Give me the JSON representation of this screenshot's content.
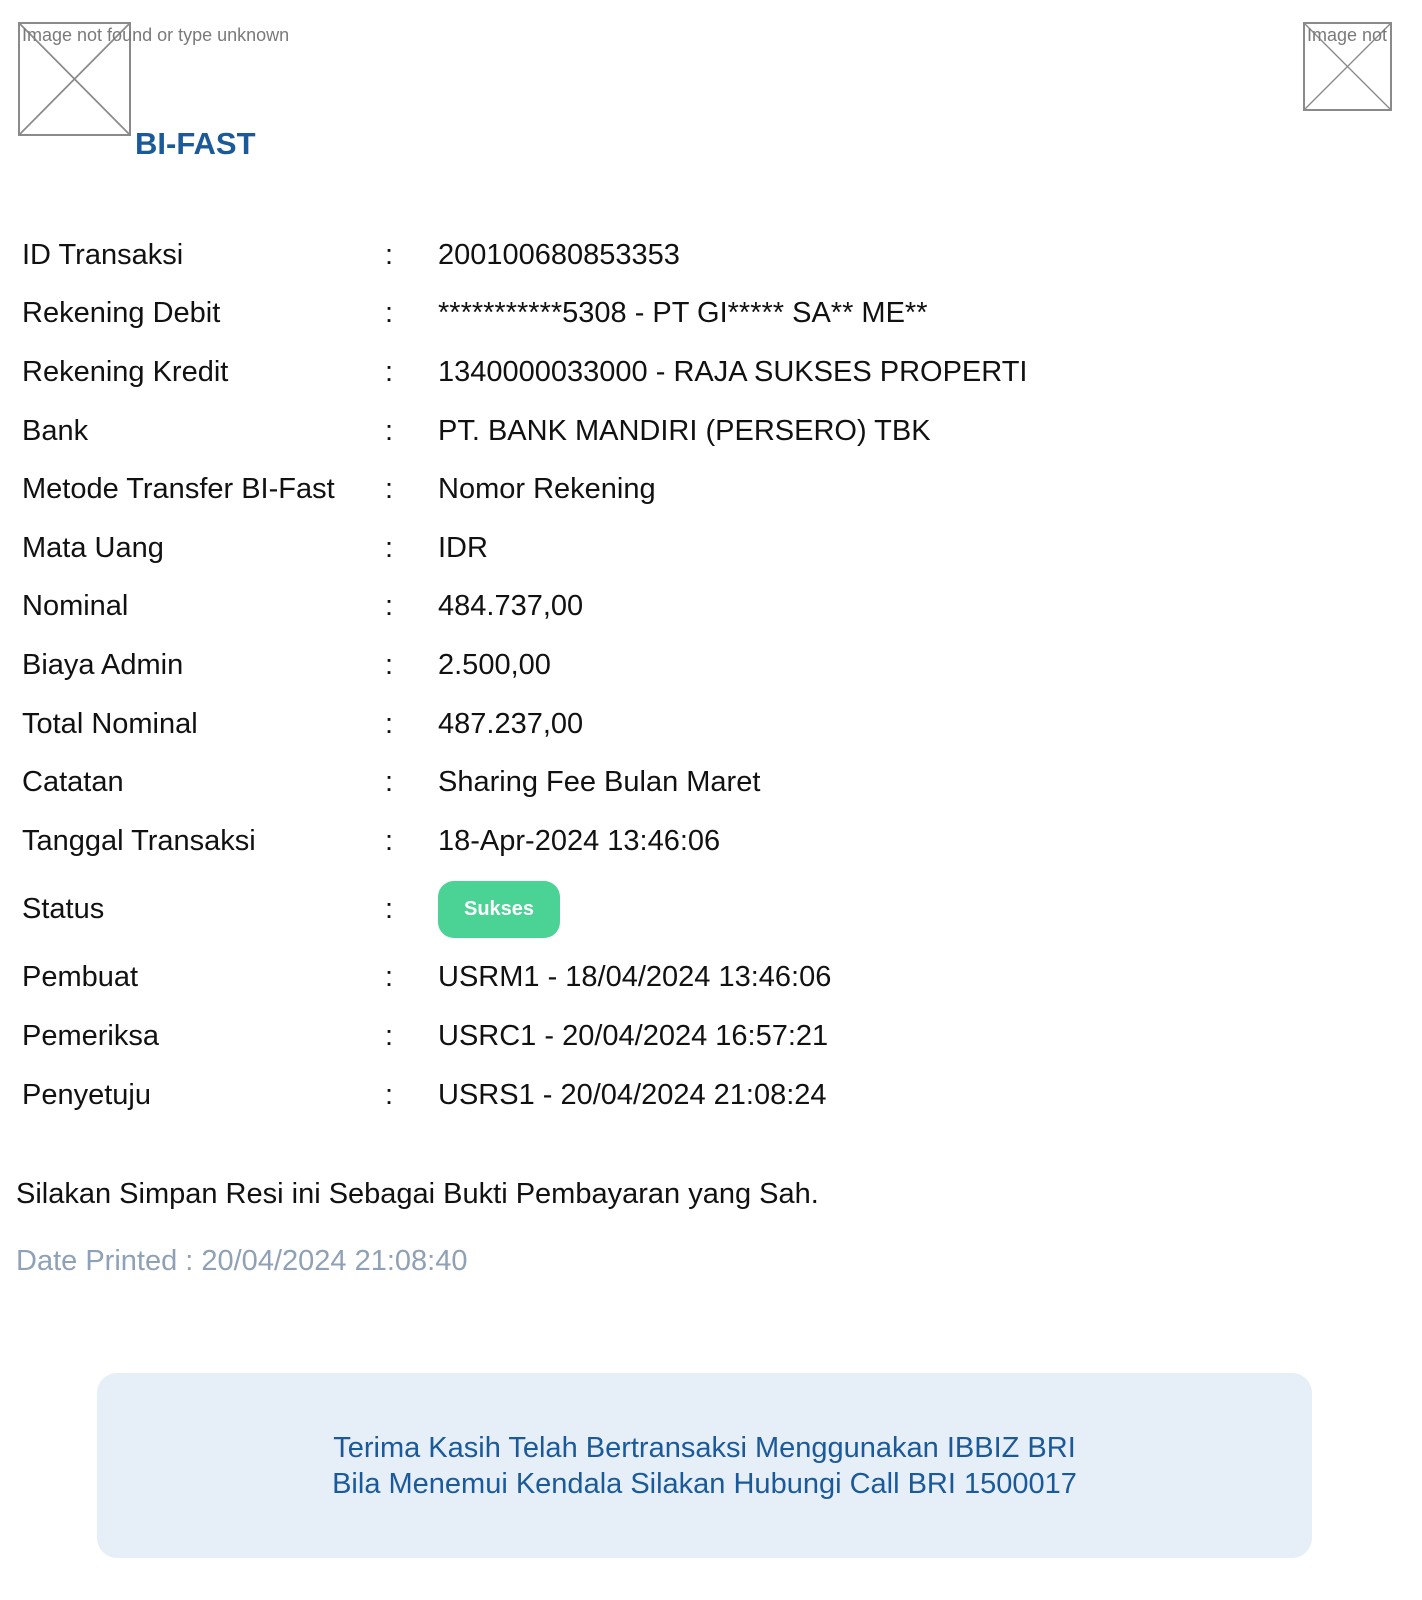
{
  "header": {
    "logo_left_alt": "Image not found or type unknown",
    "logo_right_alt": "Image not found or type unknown",
    "product_title": "BI-FAST"
  },
  "details": {
    "separator": ":",
    "rows": [
      {
        "label": "ID Transaksi",
        "value": "200100680853353"
      },
      {
        "label": "Rekening Debit",
        "value": "***********5308 - PT GI***** SA** ME**"
      },
      {
        "label": "Rekening Kredit",
        "value": "1340000033000 - RAJA SUKSES PROPERTI"
      },
      {
        "label": "Bank",
        "value": "PT. BANK MANDIRI (PERSERO) TBK"
      },
      {
        "label": "Metode Transfer BI-Fast",
        "value": "Nomor Rekening"
      },
      {
        "label": "Mata Uang",
        "value": "IDR"
      },
      {
        "label": "Nominal",
        "value": "484.737,00"
      },
      {
        "label": "Biaya Admin",
        "value": "2.500,00"
      },
      {
        "label": "Total Nominal",
        "value": "487.237,00"
      },
      {
        "label": "Catatan",
        "value": "Sharing Fee Bulan Maret"
      },
      {
        "label": "Tanggal Transaksi",
        "value": "18-Apr-2024 13:46:06"
      }
    ],
    "status": {
      "label": "Status",
      "value": "Sukses",
      "color": "#4ad394"
    },
    "approval_rows": [
      {
        "label": "Pembuat",
        "value": "USRM1 - 18/04/2024 13:46:06"
      },
      {
        "label": "Pemeriksa",
        "value": "USRC1 - 20/04/2024 16:57:21"
      },
      {
        "label": "Penyetuju",
        "value": "USRS1 - 20/04/2024 21:08:24"
      }
    ]
  },
  "save_note": "Silakan Simpan Resi ini Sebagai Bukti Pembayaran yang Sah.",
  "date_printed": "Date Printed : 20/04/2024 21:08:40",
  "footer": {
    "line1": "Terima Kasih Telah Bertransaksi Menggunakan IBBIZ BRI",
    "line2": "Bila Menemui Kendala Silakan Hubungi Call BRI 1500017"
  },
  "colors": {
    "brand_blue": "#1a5a9a",
    "status_success": "#4ad394",
    "muted_text": "#8fa1b6",
    "footer_bg": "#e6eef8"
  }
}
